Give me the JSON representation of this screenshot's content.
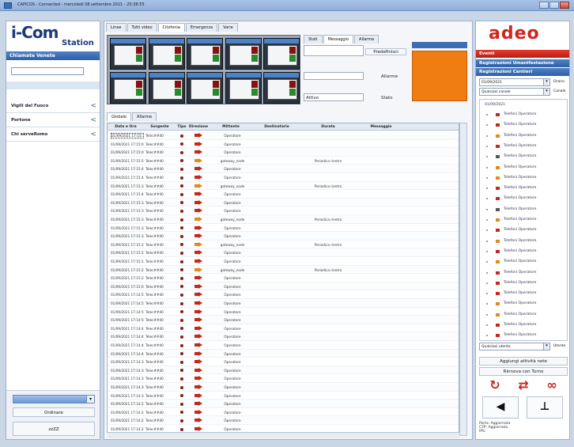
{
  "window": {
    "title": "CAPICOS - Connected - mercoledì 08 settembre 2021 - 20:38:55"
  },
  "left": {
    "logo_main": "i-Com",
    "logo_sub": "Station",
    "panel_title": "Chiamate Venete",
    "search_placeholder": "",
    "nav": [
      {
        "label": "Vigili del Fuoco"
      },
      {
        "label": "Portone"
      },
      {
        "label": "Chi serveRomo"
      }
    ],
    "combo_value": "",
    "btn1": "Ordinare",
    "btn2": "zzZZ"
  },
  "center": {
    "tabs": [
      "Linee",
      "Tutti video",
      "Citofonia",
      "Emergenza",
      "Varie"
    ],
    "mini_tabs": [
      "Stati",
      "Messaggio",
      "Allarme"
    ],
    "labels": {
      "allarme": "Allarme",
      "stato": "Stato",
      "status_text": "Attivo"
    },
    "orange_text": "",
    "btn_small": "Predefinisci",
    "subtabs": [
      "Globale",
      "Allarme"
    ],
    "columns": [
      "Data e Ora",
      "Sorgente",
      "Tipo",
      "Direzione",
      "Mittente",
      "Destinatario",
      "Durata",
      "Messaggio"
    ],
    "rows": [
      {
        "dt": "01/09/2021 17:15:16",
        "src": "Telec##40",
        "arrow": "red",
        "sender": "Operatore",
        "dur": ""
      },
      {
        "dt": "01/09/2021 17:15:03",
        "src": "Telec##40",
        "arrow": "red",
        "sender": "Operatore",
        "dur": ""
      },
      {
        "dt": "01/09/2021 17:15:00",
        "src": "Telec##40",
        "arrow": "red",
        "sender": "Operatore",
        "dur": ""
      },
      {
        "dt": "01/09/2021 17:15:56",
        "src": "Telec##40",
        "arrow": "orange",
        "sender": "gateway_node",
        "dur": "Periodica rientro"
      },
      {
        "dt": "01/09/2021 17:15:47",
        "src": "Telec##40",
        "arrow": "red",
        "sender": "Operatore",
        "dur": ""
      },
      {
        "dt": "01/09/2021 17:15:43",
        "src": "Telec##40",
        "arrow": "red",
        "sender": "Operatore",
        "dur": ""
      },
      {
        "dt": "01/09/2021 17:15:35",
        "src": "Telec##40",
        "arrow": "orange",
        "sender": "gateway_node",
        "dur": "Periodica rientro"
      },
      {
        "dt": "01/09/2021 17:15:44",
        "src": "Telec##40",
        "arrow": "red",
        "sender": "Operatore",
        "dur": ""
      },
      {
        "dt": "01/09/2021 17:15:34",
        "src": "Telec##40",
        "arrow": "red",
        "sender": "Operatore",
        "dur": ""
      },
      {
        "dt": "01/09/2021 17:15:30",
        "src": "Telec##40",
        "arrow": "red",
        "sender": "Operatore",
        "dur": ""
      },
      {
        "dt": "01/09/2021 17:15:33",
        "src": "Telec##40",
        "arrow": "orange",
        "sender": "gateway_node",
        "dur": "Periodica rientro"
      },
      {
        "dt": "01/09/2021 17:15:33",
        "src": "Telec##40",
        "arrow": "red",
        "sender": "Operatore",
        "dur": ""
      },
      {
        "dt": "01/09/2021 17:15:33",
        "src": "Telec##40",
        "arrow": "red",
        "sender": "Operatore",
        "dur": ""
      },
      {
        "dt": "01/09/2021 17:15:29",
        "src": "Telec##40",
        "arrow": "orange",
        "sender": "gateway_node",
        "dur": "Periodica rientro"
      },
      {
        "dt": "01/09/2021 17:15:26",
        "src": "Telec##40",
        "arrow": "red",
        "sender": "Operatore",
        "dur": ""
      },
      {
        "dt": "01/09/2021 17:15:25",
        "src": "Telec##40",
        "arrow": "red",
        "sender": "Operatore",
        "dur": ""
      },
      {
        "dt": "01/09/2021 17:15:22",
        "src": "Telec##40",
        "arrow": "orange",
        "sender": "gateway_node",
        "dur": "Periodica rientro"
      },
      {
        "dt": "01/09/2021 17:15:20",
        "src": "Telec##40",
        "arrow": "red",
        "sender": "Operatore",
        "dur": ""
      },
      {
        "dt": "01/09/2021 17:15:03",
        "src": "Telec##40",
        "arrow": "red",
        "sender": "Operatore",
        "dur": ""
      },
      {
        "dt": "01/09/2021 17:14:55",
        "src": "Telec##40",
        "arrow": "red",
        "sender": "Operatore",
        "dur": ""
      },
      {
        "dt": "01/09/2021 17:14:54",
        "src": "Telec##40",
        "arrow": "red",
        "sender": "Operatore",
        "dur": ""
      },
      {
        "dt": "01/09/2021 17:14:50",
        "src": "Telec##40",
        "arrow": "red",
        "sender": "Operatore",
        "dur": ""
      },
      {
        "dt": "01/09/2021 17:14:50",
        "src": "Telec##40",
        "arrow": "red",
        "sender": "Operatore",
        "dur": ""
      },
      {
        "dt": "01/09/2021 17:14:44",
        "src": "Telec##40",
        "arrow": "red",
        "sender": "Operatore",
        "dur": ""
      },
      {
        "dt": "01/09/2021 17:14:41",
        "src": "Telec##40",
        "arrow": "red",
        "sender": "Operatore",
        "dur": ""
      },
      {
        "dt": "01/09/2021 17:14:40",
        "src": "Telec##40",
        "arrow": "red",
        "sender": "Operatore",
        "dur": ""
      },
      {
        "dt": "01/09/2021 17:14:40",
        "src": "Telec##40",
        "arrow": "red",
        "sender": "Operatore",
        "dur": ""
      },
      {
        "dt": "01/09/2021 17:14:36",
        "src": "Telec##40",
        "arrow": "red",
        "sender": "Operatore",
        "dur": ""
      },
      {
        "dt": "01/09/2021 17:14:34",
        "src": "Telec##40",
        "arrow": "red",
        "sender": "Operatore",
        "dur": ""
      },
      {
        "dt": "01/09/2021 17:14:33",
        "src": "Telec##40",
        "arrow": "red",
        "sender": "Operatore",
        "dur": ""
      },
      {
        "dt": "01/09/2021 17:14:30",
        "src": "Telec##40",
        "arrow": "red",
        "sender": "Operatore",
        "dur": ""
      },
      {
        "dt": "01/09/2021 17:14:30",
        "src": "Telec##40",
        "arrow": "red",
        "sender": "Operatore",
        "dur": ""
      },
      {
        "dt": "01/09/2021 17:14:28",
        "src": "Telec##40",
        "arrow": "red",
        "sender": "Operatore",
        "dur": ""
      },
      {
        "dt": "01/09/2021 17:14:25",
        "src": "Telec##40",
        "arrow": "red",
        "sender": "Operatore",
        "dur": ""
      },
      {
        "dt": "01/09/2021 17:14:25",
        "src": "Telec##40",
        "arrow": "red",
        "sender": "Operatore",
        "dur": ""
      },
      {
        "dt": "01/09/2021 17:14:24",
        "src": "Telec##40",
        "arrow": "red",
        "sender": "Operatore",
        "dur": ""
      },
      {
        "dt": "01/09/2021 17:14:20",
        "src": "Telec##40",
        "arrow": "red",
        "sender": "Operatore",
        "dur": ""
      }
    ]
  },
  "right": {
    "logo": "adeo",
    "bar_red": "Eventi",
    "bar1": "Registrazioni Umanifestazione",
    "bar2": "Registrazioni Cantieri",
    "selects": [
      {
        "v": "01/09/2021",
        "side": "Orario"
      },
      {
        "v": "Qualsiasi canale",
        "side": "Canale"
      },
      {
        "v": "Qualsiasi utente",
        "side": "Utente"
      }
    ],
    "tree_root": "01/09/2021",
    "tree_item": "Telefoni Operatore",
    "tree_count": 22,
    "btn_a": "Aggiungi attività note",
    "btn_b": "Rinnova con Turno",
    "status1": "Porta: Aggiornata",
    "status2": "CYP: Aggiornata",
    "status3": "IPS:"
  },
  "colors": {
    "accent": "#2f5ea6",
    "brand_red": "#d0261e",
    "orange": "#f07d12"
  }
}
